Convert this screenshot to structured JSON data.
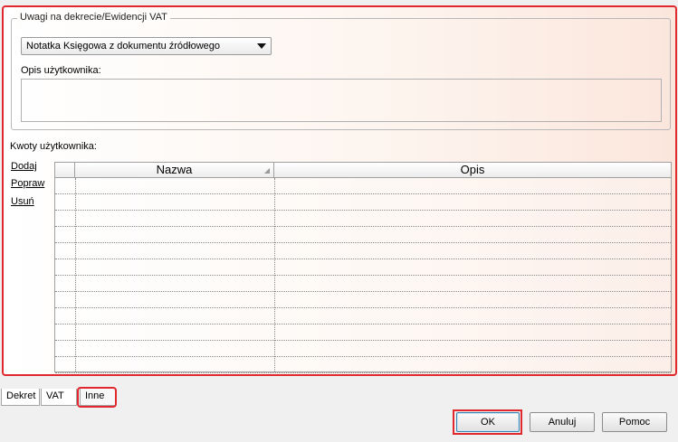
{
  "uwagi": {
    "legend": "Uwagi na dekrecie/Ewidencji VAT",
    "combo_value": "Notatka Księgowa z dokumentu źródłowego",
    "opis_label": "Opis użytkownika:",
    "opis_value": ""
  },
  "kwoty": {
    "label": "Kwoty użytkownika:",
    "actions": [
      "Dodaj",
      "Popraw",
      "Usuń"
    ],
    "columns": [
      "Nazwa",
      "Opis"
    ],
    "rows": []
  },
  "tabs": [
    {
      "label": "Dekret",
      "active": false
    },
    {
      "label": "VAT",
      "active": false
    },
    {
      "label": "Inne",
      "active": true
    }
  ],
  "buttons": {
    "ok": "OK",
    "cancel": "Anuluj",
    "help": "Pomoc"
  },
  "colors": {
    "highlight": "#e0282e"
  }
}
